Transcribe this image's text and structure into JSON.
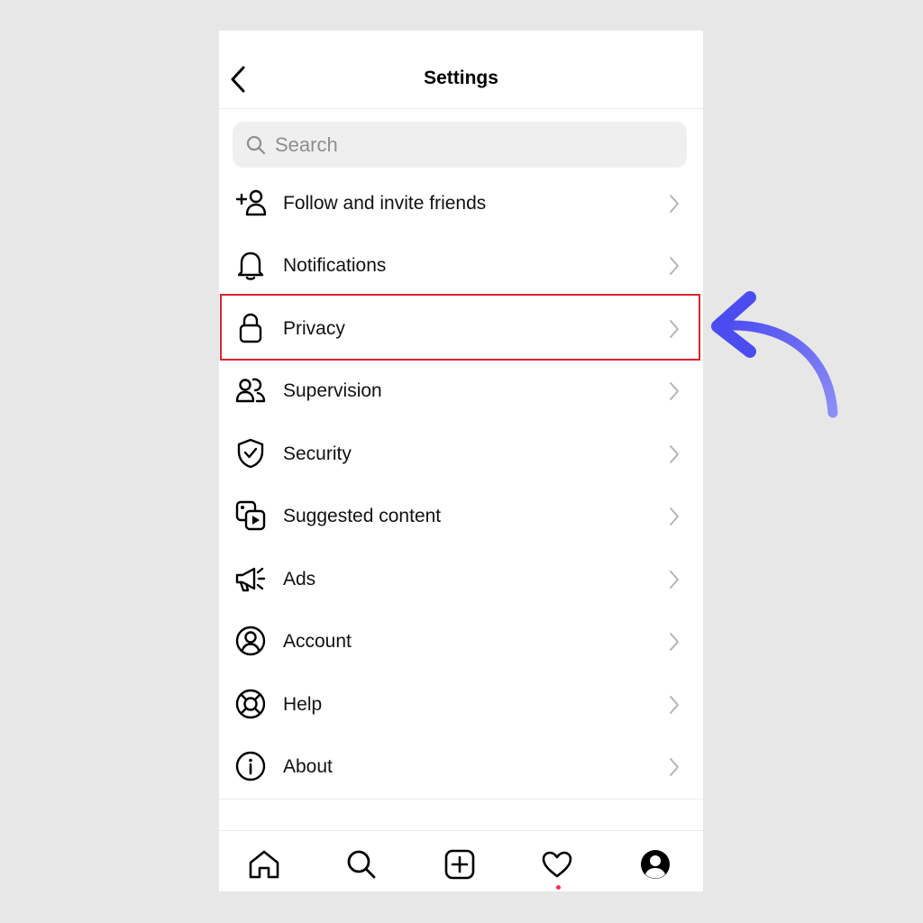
{
  "header": {
    "title": "Settings"
  },
  "search": {
    "placeholder": "Search",
    "value": ""
  },
  "menu": {
    "items": [
      {
        "label": "Follow and invite friends",
        "icon": "add-person-icon"
      },
      {
        "label": "Notifications",
        "icon": "bell-icon"
      },
      {
        "label": "Privacy",
        "icon": "lock-icon",
        "highlighted": true
      },
      {
        "label": "Supervision",
        "icon": "people-icon"
      },
      {
        "label": "Security",
        "icon": "shield-check-icon"
      },
      {
        "label": "Suggested content",
        "icon": "media-play-icon"
      },
      {
        "label": "Ads",
        "icon": "megaphone-icon"
      },
      {
        "label": "Account",
        "icon": "user-circle-icon"
      },
      {
        "label": "Help",
        "icon": "lifebuoy-icon"
      },
      {
        "label": "About",
        "icon": "info-icon"
      }
    ]
  },
  "tabbar": {
    "tabs": [
      "home-icon",
      "search-icon",
      "new-post-icon",
      "heart-icon",
      "profile-icon"
    ]
  },
  "colors": {
    "highlight_border": "#d9242c",
    "annotation_arrow": "#5a5cf2",
    "notification_dot": "#ff2d55"
  }
}
